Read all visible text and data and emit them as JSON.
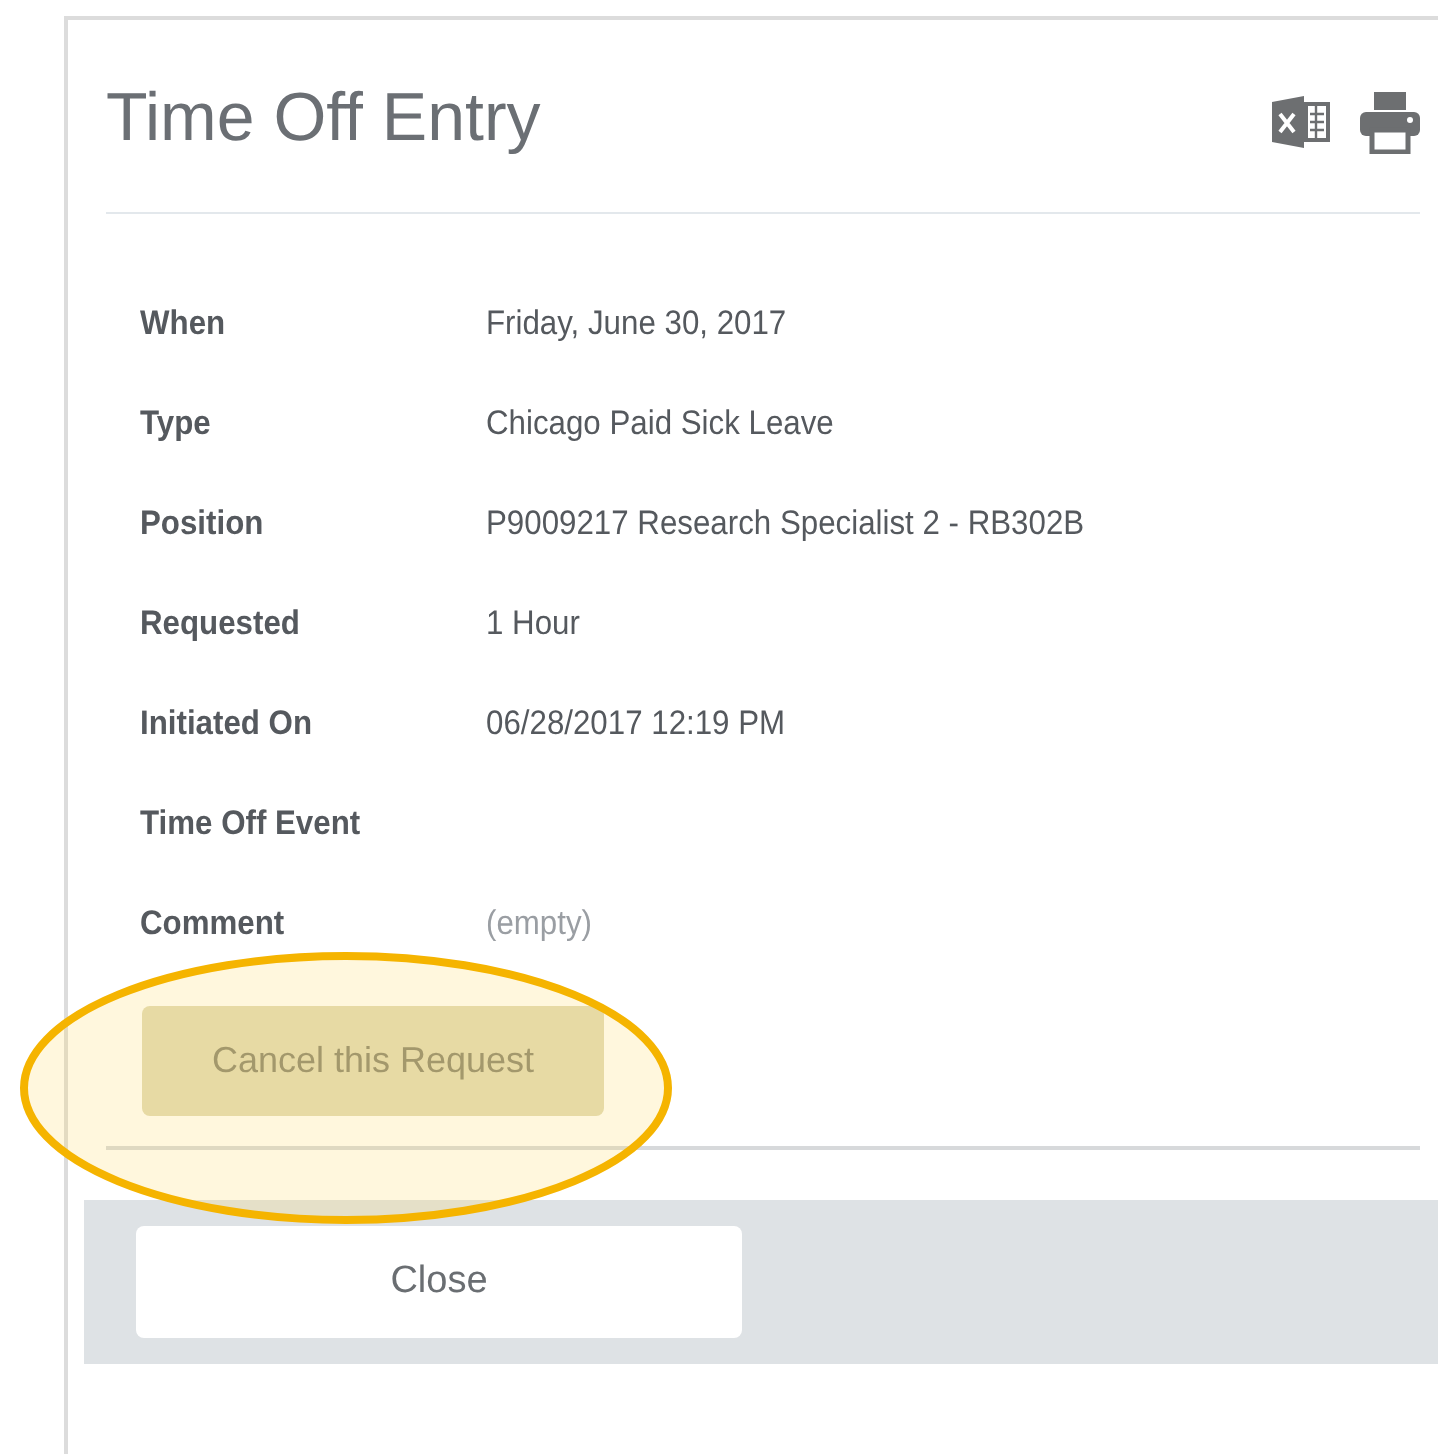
{
  "dialog": {
    "title": "Time Off Entry"
  },
  "fields": [
    {
      "label": "When",
      "value": "Friday, June 30, 2017",
      "kind": "text"
    },
    {
      "label": "Type",
      "value": "Chicago Paid Sick Leave",
      "kind": "text"
    },
    {
      "label": "Position",
      "value": "P9009217 Research Specialist 2 - RB302B",
      "kind": "text"
    },
    {
      "label": "Requested",
      "value": "1 Hour",
      "kind": "text"
    },
    {
      "label": "Initiated On",
      "value": "06/28/2017 12:19 PM",
      "kind": "text"
    },
    {
      "label": "Time Off Event"
    },
    {
      "label": "Comment",
      "value": "(empty)",
      "kind": "empty"
    }
  ],
  "action_button": "Cancel this Request",
  "footer_button": "Close"
}
